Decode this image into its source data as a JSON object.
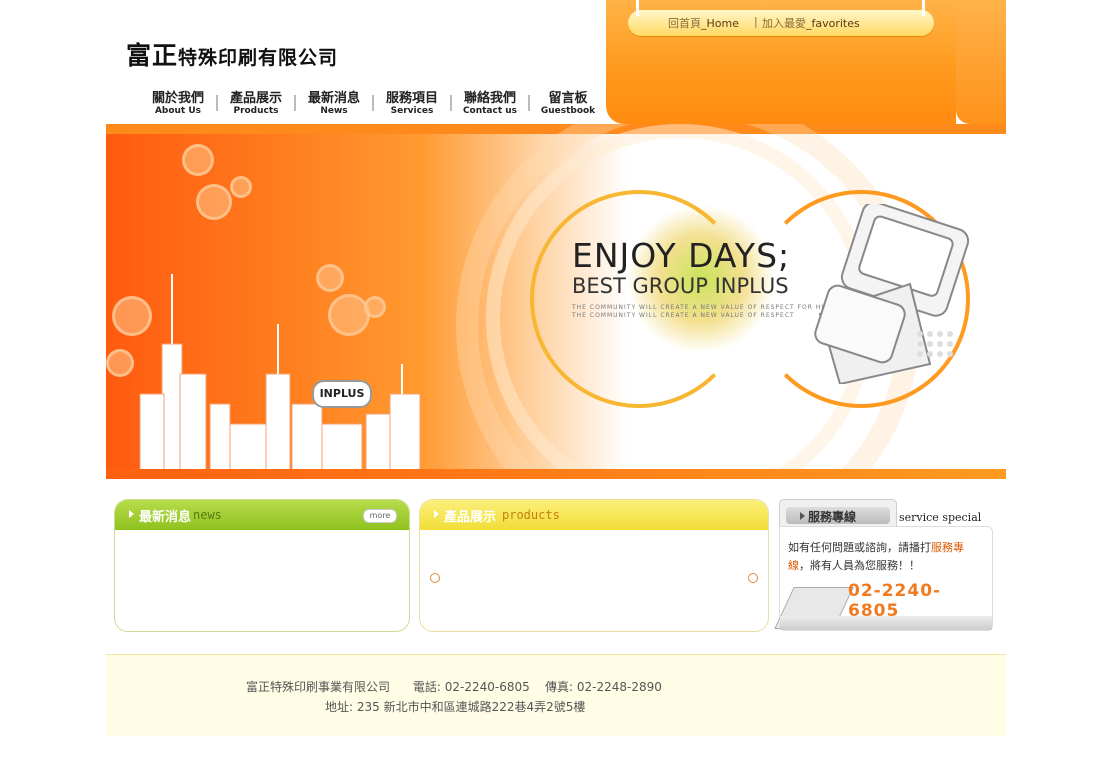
{
  "header": {
    "logo_big": "富正",
    "logo_small": "特殊印刷有限公司"
  },
  "topnav": {
    "home_zh": "回首頁",
    "home_en": "_Home",
    "separator": "|",
    "fav_zh": "加入最愛",
    "fav_en": "_favorites"
  },
  "mainnav": [
    {
      "zh": "關於我們",
      "en": "About Us"
    },
    {
      "zh": "產品展示",
      "en": "Products"
    },
    {
      "zh": "最新消息",
      "en": "News"
    },
    {
      "zh": "服務項目",
      "en": "Services"
    },
    {
      "zh": "聯絡我們",
      "en": "Contact us"
    },
    {
      "zh": "留言板",
      "en": "Guestbook"
    }
  ],
  "banner": {
    "headline": "ENJOY DAYS;",
    "subheadline": "BEST GROUP INPLUS",
    "tagline1": "THE COMMUNITY WILL CREATE A NEW VALUE OF RESPECT FOR HUMAN DIGNITY",
    "tagline2": "THE COMMUNITY WILL CREATE A NEW VALUE OF RESPECT",
    "sign": "INPLUS"
  },
  "news_box": {
    "title_zh": "最新消息",
    "title_en": "news",
    "more": "more"
  },
  "products_box": {
    "title_zh": "產品展示",
    "title_en": "products"
  },
  "service_box": {
    "title_zh": "服務專線",
    "title_en": "service special Line",
    "text_before": "如有任何問題或諮詢，請播打",
    "text_highlight": "服務專線",
    "text_after": "，將有人員為您服務！！",
    "phone": "02-2240-6805"
  },
  "footer": {
    "line1": "富正特殊印刷事業有限公司      電話: 02-2240-6805    傳真: 02-2248-2890",
    "line2": "地址: 235 新北市中和區連城路222巷4弄2號5樓"
  },
  "colors": {
    "orange": "#ff8c10",
    "green": "#8fc21e",
    "yellow": "#f1de36",
    "accent_text": "#e05a00"
  }
}
